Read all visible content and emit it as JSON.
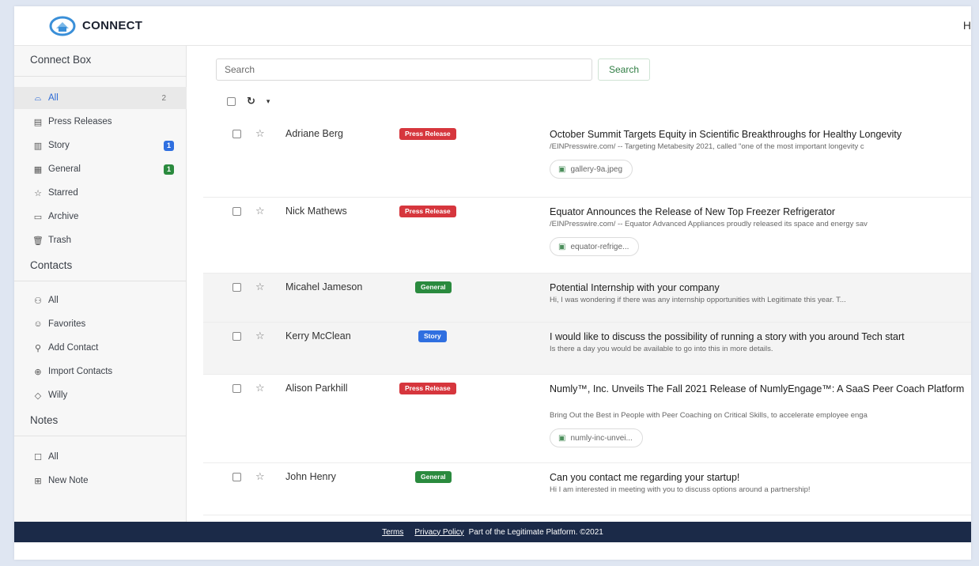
{
  "header": {
    "brand": "CONNECT",
    "right_text": "H"
  },
  "sidebar": {
    "connect_box_title": "Connect Box",
    "connect_items": [
      {
        "label": "All",
        "count": "2"
      },
      {
        "label": "Press Releases"
      },
      {
        "label": "Story",
        "badge": "1"
      },
      {
        "label": "General",
        "badge": "1"
      },
      {
        "label": "Starred"
      },
      {
        "label": "Archive"
      },
      {
        "label": "Trash"
      }
    ],
    "contacts_title": "Contacts",
    "contact_items": [
      {
        "label": "All"
      },
      {
        "label": "Favorites"
      },
      {
        "label": "Add Contact"
      },
      {
        "label": "Import Contacts"
      },
      {
        "label": "Willy"
      }
    ],
    "notes_title": "Notes",
    "note_items": [
      {
        "label": "All"
      },
      {
        "label": "New Note"
      }
    ]
  },
  "search": {
    "placeholder": "Search",
    "button_label": "Search"
  },
  "colors": {
    "press_release": "#d6363d",
    "general": "#2a8a3e",
    "story": "#2f6fe0",
    "story_badge": "#2f6fe0",
    "general_badge": "#2a8a3e",
    "footer_bg": "#1b2a48"
  },
  "messages": [
    {
      "sender": "Adriane Berg",
      "tag": "Press Release",
      "subject": "October Summit Targets Equity in Scientific Breakthroughs for Healthy Longevity",
      "snippet": "/EINPresswire.com/ -- Targeting Metabesity 2021, called \"one of the most important longevity c",
      "attachment": "gallery-9a.jpeg"
    },
    {
      "sender": "Nick Mathews",
      "tag": "Press Release",
      "subject": "Equator Announces the Release of New Top Freezer Refrigerator",
      "snippet": "/EINPresswire.com/ -- Equator Advanced Appliances proudly released its space and energy sav",
      "attachment": "equator-refrige..."
    },
    {
      "sender": "Micahel Jameson",
      "tag": "General",
      "subject": "Potential Internship with your company",
      "snippet": "Hi, I was wondering if there was any internship opportunities with Legitimate this year. T..."
    },
    {
      "sender": "Kerry McClean",
      "tag": "Story",
      "subject": "I would like to discuss the possibility of running a story with you around Tech start",
      "snippet": "Is there a day you would be available to go into this in more details."
    },
    {
      "sender": "Alison Parkhill",
      "tag": "Press Release",
      "subject": "Numly™, Inc. Unveils The Fall 2021 Release of NumlyEngage™: A SaaS Peer Coach Platform",
      "snippet": "Bring Out the Best in People with Peer Coaching on Critical Skills, to accelerate employee enga",
      "attachment": "numly-inc-unvei..."
    },
    {
      "sender": "John Henry",
      "tag": "General",
      "subject": "Can you contact me regarding your startup!",
      "snippet": "Hi I am interested in meeting with you to discuss options around a partnership!"
    }
  ],
  "footer": {
    "terms": "Terms",
    "privacy": "Privacy Policy",
    "text": "Part of the Legitimate Platform. ©2021"
  }
}
